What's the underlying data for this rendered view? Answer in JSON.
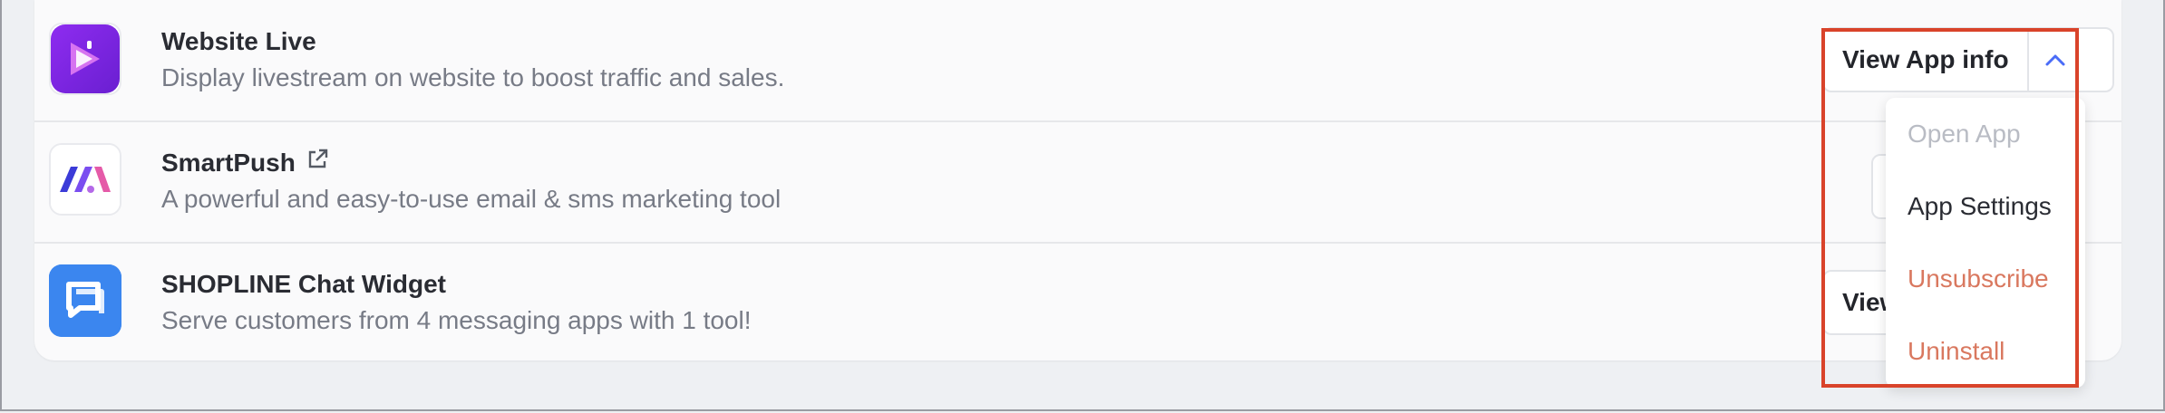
{
  "apps": [
    {
      "title": "Website Live",
      "description": "Display livestream on website to boost traffic and sales.",
      "logo": "website-live-logo"
    },
    {
      "title": "SmartPush",
      "description": "A powerful and easy-to-use email & sms marketing tool",
      "logo": "smartpush-logo",
      "external_link_icon": "external-link-icon"
    },
    {
      "title": "SHOPLINE Chat Widget",
      "description": "Serve customers from 4 messaging apps with 1 tool!",
      "logo": "chat-widget-logo"
    }
  ],
  "view_app_info": {
    "label": "View App info",
    "partial_label": "View"
  },
  "dropdown": {
    "items": [
      {
        "label": "Open App",
        "state": "disabled"
      },
      {
        "label": "App Settings",
        "state": "normal"
      },
      {
        "label": "Unsubscribe",
        "state": "danger"
      },
      {
        "label": "Uninstall",
        "state": "danger"
      }
    ]
  },
  "colors": {
    "danger": "#d9785f",
    "disabled": "#b9bcc4",
    "accent": "#4a6cf7",
    "highlight": "#d9432a"
  }
}
